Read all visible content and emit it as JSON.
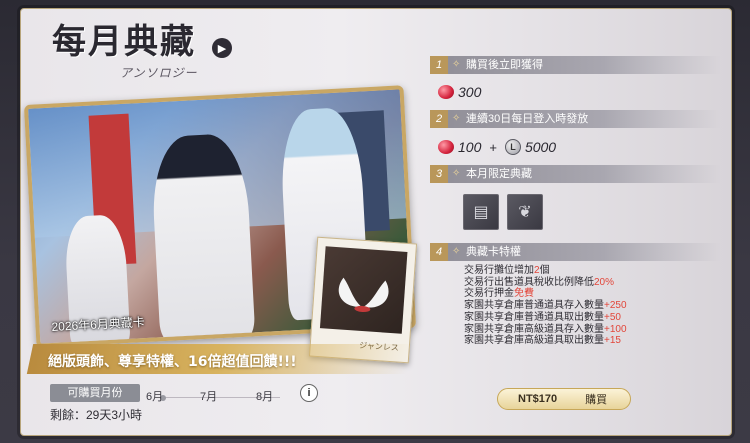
{
  "title": "每月典藏",
  "title_sub": "アンソロジー",
  "card_label": "2026年6月典藏卡",
  "polaroid_caption": "ジャンレス",
  "banner": "絕版頭飾、尊享特權、16倍超值回饋!!!",
  "months": {
    "label": "可購買月份",
    "items": [
      "6月",
      "7月",
      "8月"
    ]
  },
  "remaining": "剩餘：29天3小時",
  "sections": [
    {
      "num": "1",
      "title": "購買後立即獲得"
    },
    {
      "num": "2",
      "title": "連續30日每日登入時發放"
    },
    {
      "num": "3",
      "title": "本月限定典藏"
    },
    {
      "num": "4",
      "title": "典藏卡特權"
    }
  ],
  "rewards": {
    "immediate_gems": "300",
    "daily_gems": "100",
    "plus": "+",
    "daily_coins": "5000"
  },
  "perks": [
    {
      "pre": "交易行攤位增加",
      "hl": "2",
      "post": "個"
    },
    {
      "pre": "交易行出售道具稅收比例降低",
      "hl": "20%",
      "post": ""
    },
    {
      "pre": "交易行押金",
      "hl": "免費",
      "post": ""
    },
    {
      "pre": "家園共享倉庫普通道具存入數量",
      "hl": "+250",
      "post": ""
    },
    {
      "pre": "家園共享倉庫普通道具取出數量",
      "hl": "+50",
      "post": ""
    },
    {
      "pre": "家園共享倉庫高級道具存入數量",
      "hl": "+100",
      "post": ""
    },
    {
      "pre": "家園共享倉庫高級道具取出數量",
      "hl": "+15",
      "post": ""
    }
  ],
  "buy": {
    "price": "NT$170",
    "label": "購買"
  },
  "colors": {
    "accent_gold": "#c9a764",
    "highlight_red": "#e2463a",
    "header_gray": "#8f8d96"
  }
}
